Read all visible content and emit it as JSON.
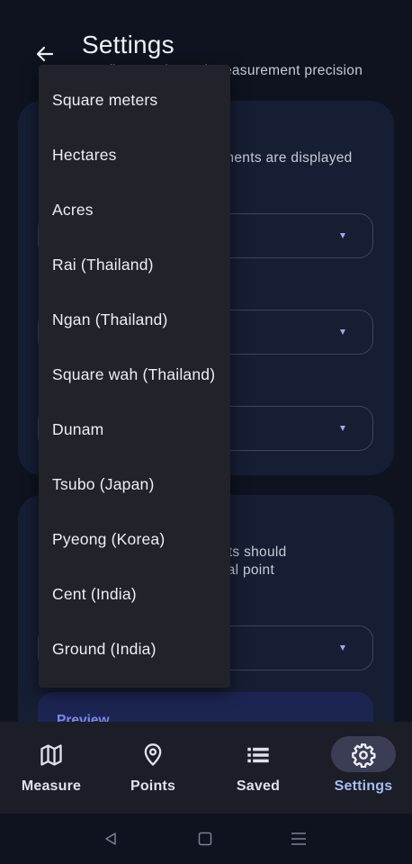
{
  "header": {
    "title": "Settings",
    "subtitle": "Configure units and measurement precision"
  },
  "units_card": {
    "description": "Choose how measurements are displayed"
  },
  "precision_card": {
    "description_line1": "Choose how many digits should",
    "description_line2": "appear after the decimal point",
    "preview_label": "Preview"
  },
  "area_unit_menu": {
    "options": [
      "Square meters",
      "Hectares",
      "Acres",
      "Rai (Thailand)",
      "Ngan (Thailand)",
      "Square wah (Thailand)",
      "Dunam",
      "Tsubo (Japan)",
      "Pyeong (Korea)",
      "Cent (India)",
      "Ground (India)"
    ]
  },
  "bottom_nav": {
    "items": [
      {
        "label": "Measure",
        "icon": "map-icon"
      },
      {
        "label": "Points",
        "icon": "location-pin-icon"
      },
      {
        "label": "Saved",
        "icon": "list-icon"
      },
      {
        "label": "Settings",
        "icon": "gear-icon",
        "active": true
      }
    ]
  },
  "system_nav": {
    "back": "back-triangle-icon",
    "home": "home-square-icon",
    "recents": "recents-lines-icon"
  },
  "colors": {
    "background": "#0e131f",
    "card": "#161e33",
    "menu": "#22232a",
    "accent": "#a6bdf2",
    "preview_accent": "#7d88e8",
    "nav_active_pill": "#3b3d55"
  }
}
